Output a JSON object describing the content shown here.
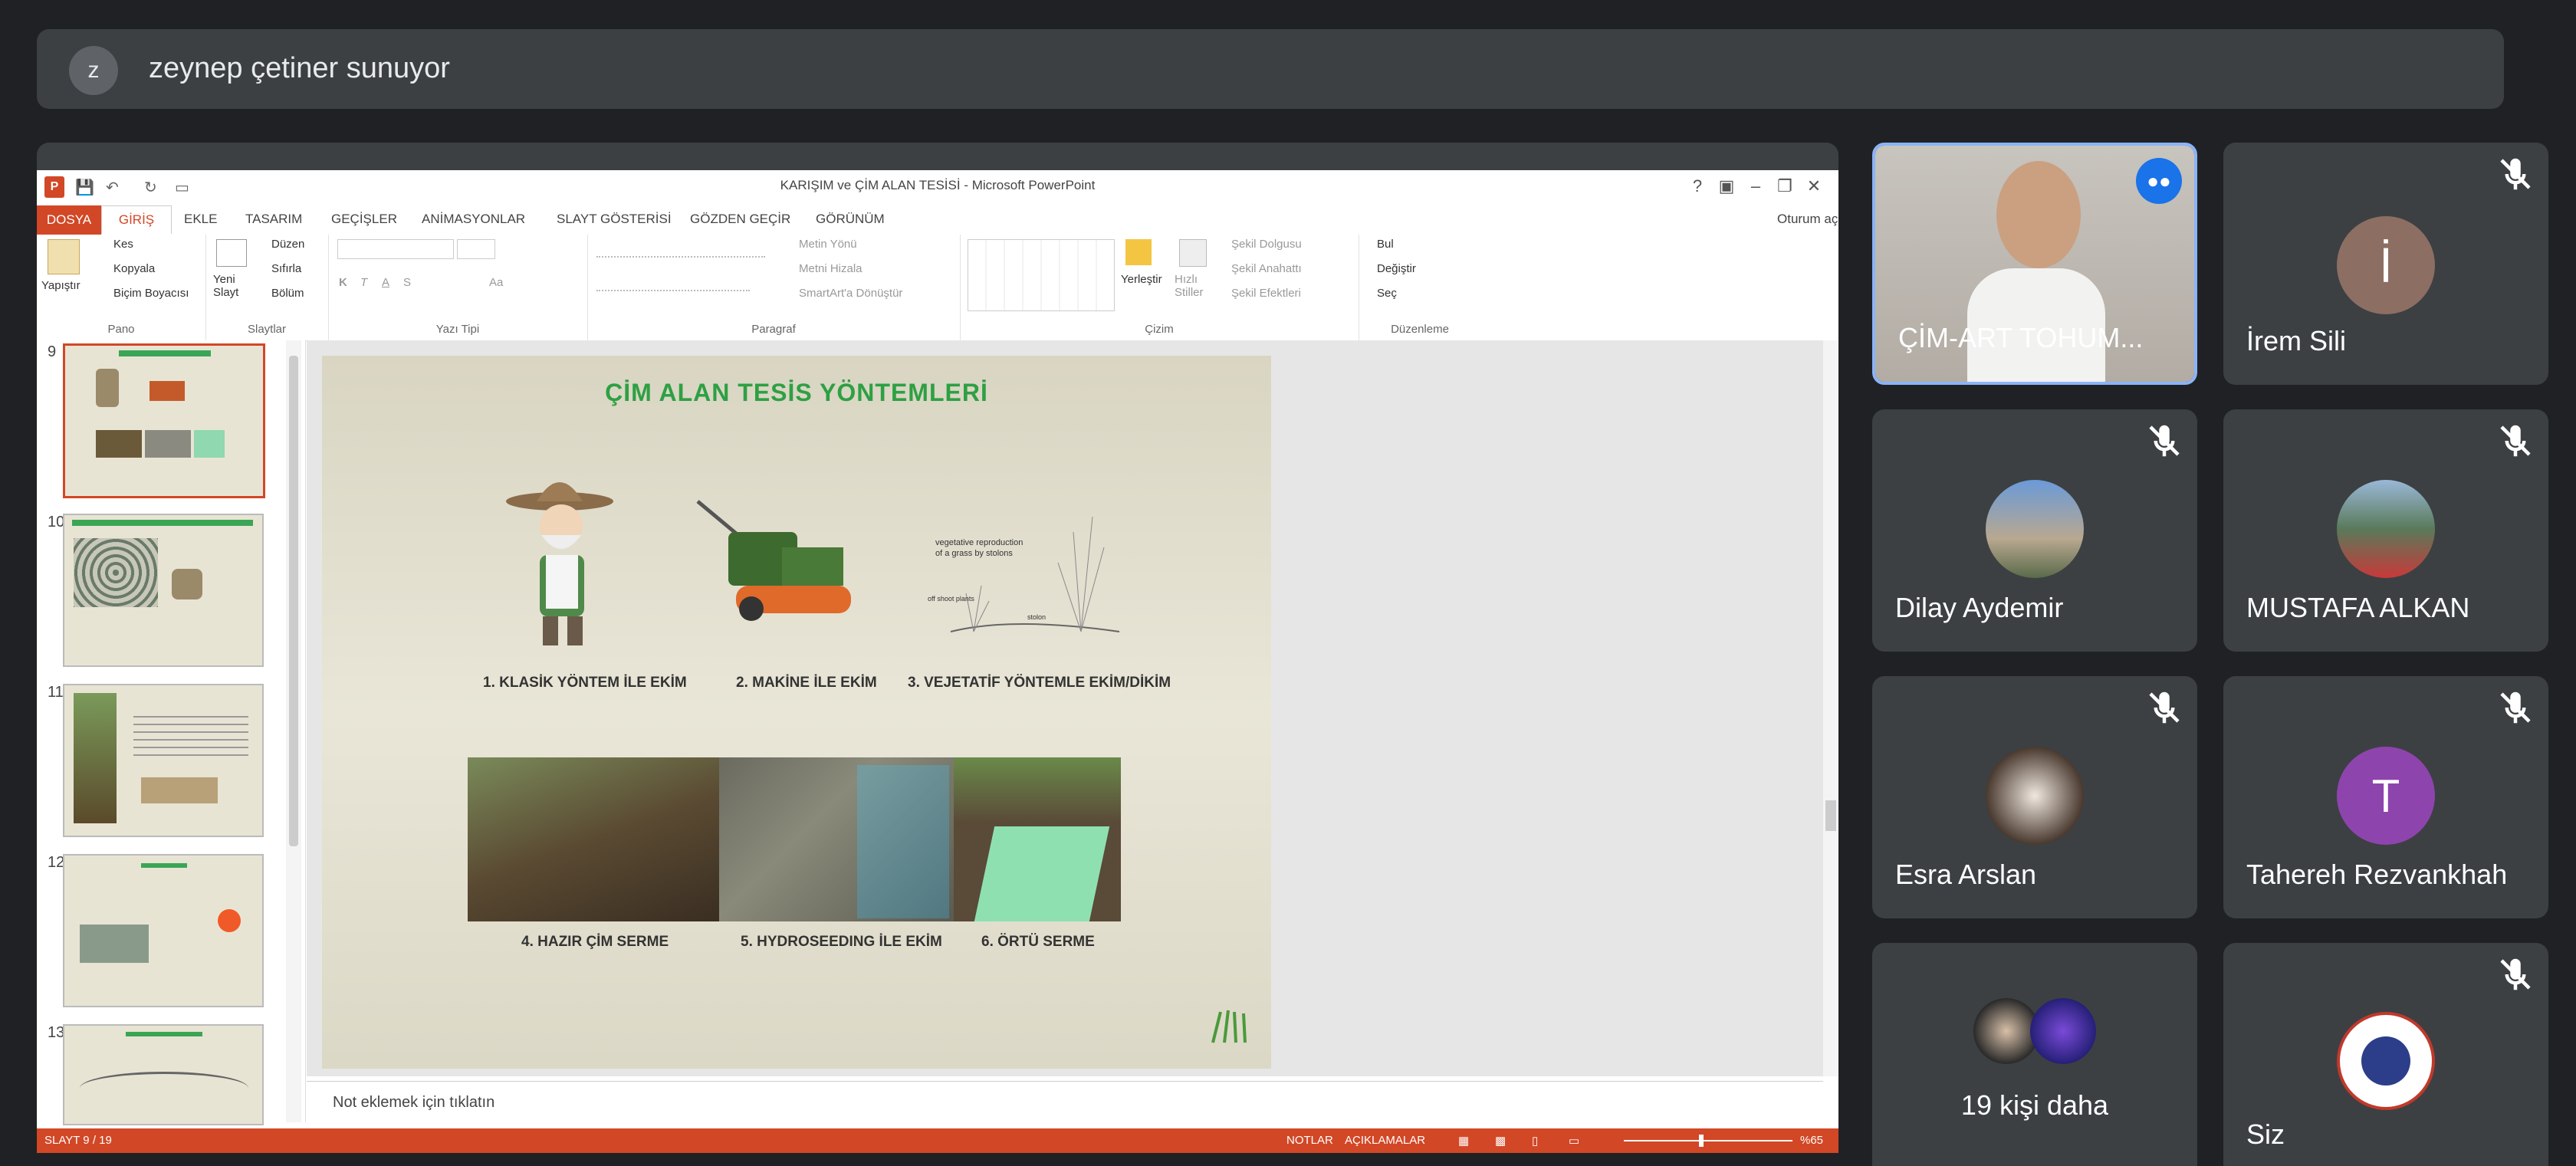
{
  "presenter_banner": {
    "avatar_letter": "z",
    "text": "zeynep çetiner sunuyor"
  },
  "powerpoint": {
    "window_title": "KARIŞIM ve ÇİM ALAN TESİSİ - Microsoft PowerPoint",
    "logo_letter": "P",
    "window_controls": [
      "?",
      "▣",
      "–",
      "❐",
      "✕"
    ],
    "user": "Oturum aç",
    "tabs": [
      "DOSYA",
      "GİRİŞ",
      "EKLE",
      "TASARIM",
      "GEÇİŞLER",
      "ANİMASYONLAR",
      "SLAYT GÖSTERİSİ",
      "GÖZDEN GEÇİR",
      "GÖRÜNÜM"
    ],
    "ribbon": {
      "pano": {
        "label": "Pano",
        "paste": "Yapıştır",
        "cut": "Kes",
        "copy": "Kopyala",
        "format_painter": "Biçim Boyacısı"
      },
      "slaytlar": {
        "label": "Slaytlar",
        "new_slide": "Yeni Slayt",
        "layout": "Düzen",
        "reset": "Sıfırla",
        "section": "Bölüm"
      },
      "yazi_tipi": {
        "label": "Yazı Tipi",
        "bold": "K",
        "italic": "T",
        "underline": "A",
        "strike": "S",
        "case": "Aa"
      },
      "paragraf": {
        "label": "Paragraf",
        "text_dir": "Metin Yönü",
        "align_text": "Metni Hizala",
        "smartart": "SmartArt'a Dönüştür"
      },
      "cizim": {
        "label": "Çizim",
        "arrange": "Yerleştir",
        "quick_styles": "Hızlı Stiller",
        "fill": "Şekil Dolgusu",
        "outline": "Şekil Anahattı",
        "effects": "Şekil Efektleri"
      },
      "duzenleme": {
        "label": "Düzenleme",
        "find": "Bul",
        "replace": "Değiştir",
        "select": "Seç"
      }
    },
    "thumbnails": [
      {
        "num": "9",
        "selected": true
      },
      {
        "num": "10",
        "selected": false
      },
      {
        "num": "11",
        "selected": false
      },
      {
        "num": "12",
        "selected": false
      },
      {
        "num": "13",
        "selected": false
      }
    ],
    "slide": {
      "title": "ÇİM ALAN TESİS YÖNTEMLERİ",
      "captions": [
        "1. KLASİK YÖNTEM İLE EKİM",
        "2. MAKİNE İLE EKİM",
        "3. VEJETATİF  YÖNTEMLE EKİM/DİKİM",
        "4. HAZIR ÇİM SERME",
        "5. HYDROSEEDING İLE EKİM",
        "6. ÖRTÜ SERME"
      ],
      "plant_label_1": "vegetative reproduction",
      "plant_label_2": "of a grass by stolons",
      "plant_label_3": "off shoot plants",
      "plant_label_4": "stolon"
    },
    "notes_placeholder": "Not eklemek için tıklatın",
    "status": {
      "slide_counter": "SLAYT 9 / 19",
      "notes": "NOTLAR",
      "comments": "AÇIKLAMALAR",
      "zoom": "%65"
    }
  },
  "participants": [
    {
      "name": "ÇİM-ART TOHUM...",
      "speaking": true
    },
    {
      "name": "İrem Sili",
      "initial": "İ",
      "color": "#8d6e63"
    },
    {
      "name": "Dilay Aydemir"
    },
    {
      "name": "MUSTAFA ALKAN"
    },
    {
      "name": "Esra Arslan"
    },
    {
      "name": "Tahereh Rezvankhah",
      "initial": "T",
      "color": "#8e44ad"
    },
    {
      "name": "19 kişi daha"
    },
    {
      "name": "Siz"
    }
  ]
}
